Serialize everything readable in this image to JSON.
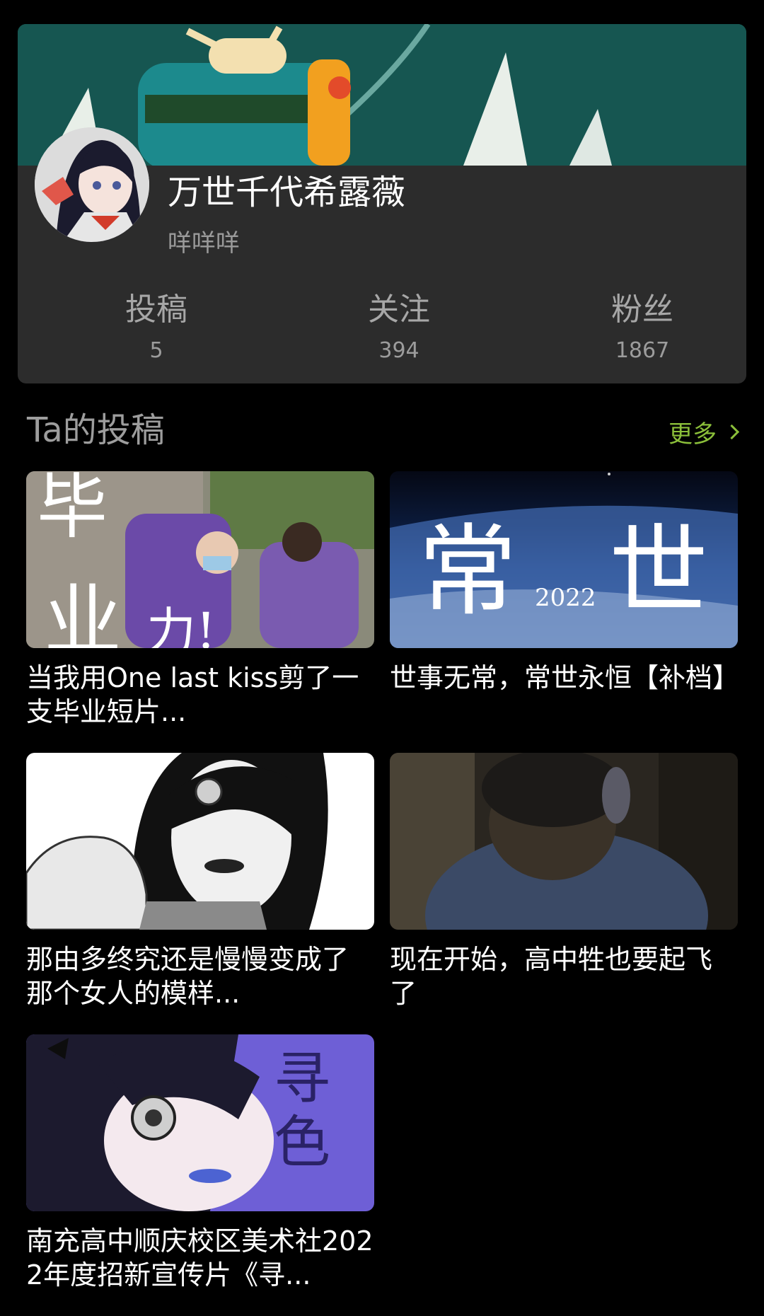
{
  "profile": {
    "username": "万世千代希露薇",
    "signature": "咩咩咩",
    "stats": [
      {
        "label": "投稿",
        "value": "5"
      },
      {
        "label": "关注",
        "value": "394"
      },
      {
        "label": "粉丝",
        "value": "1867"
      }
    ]
  },
  "section": {
    "title": "Ta的投稿",
    "more_label": "更多"
  },
  "videos": [
    {
      "title": "当我用One last kiss剪了一支毕业短片...",
      "thumb_text": [
        "毕",
        "业",
        "力!"
      ]
    },
    {
      "title": "世事无常，常世永恒【补档】",
      "thumb_text": [
        "常",
        "2022",
        "世"
      ]
    },
    {
      "title": "那由多终究还是慢慢变成了那个女人的模样..."
    },
    {
      "title": "现在开始，高中牲也要起飞了"
    },
    {
      "title": "南充高中顺庆校区美术社2022年度招新宣传片《寻...",
      "thumb_text": [
        "寻",
        "色"
      ]
    }
  ],
  "colors": {
    "background": "#000000",
    "card": "#2c2c2c",
    "accent_green": "#8bbf3a",
    "banner_teal": "#14514c"
  }
}
